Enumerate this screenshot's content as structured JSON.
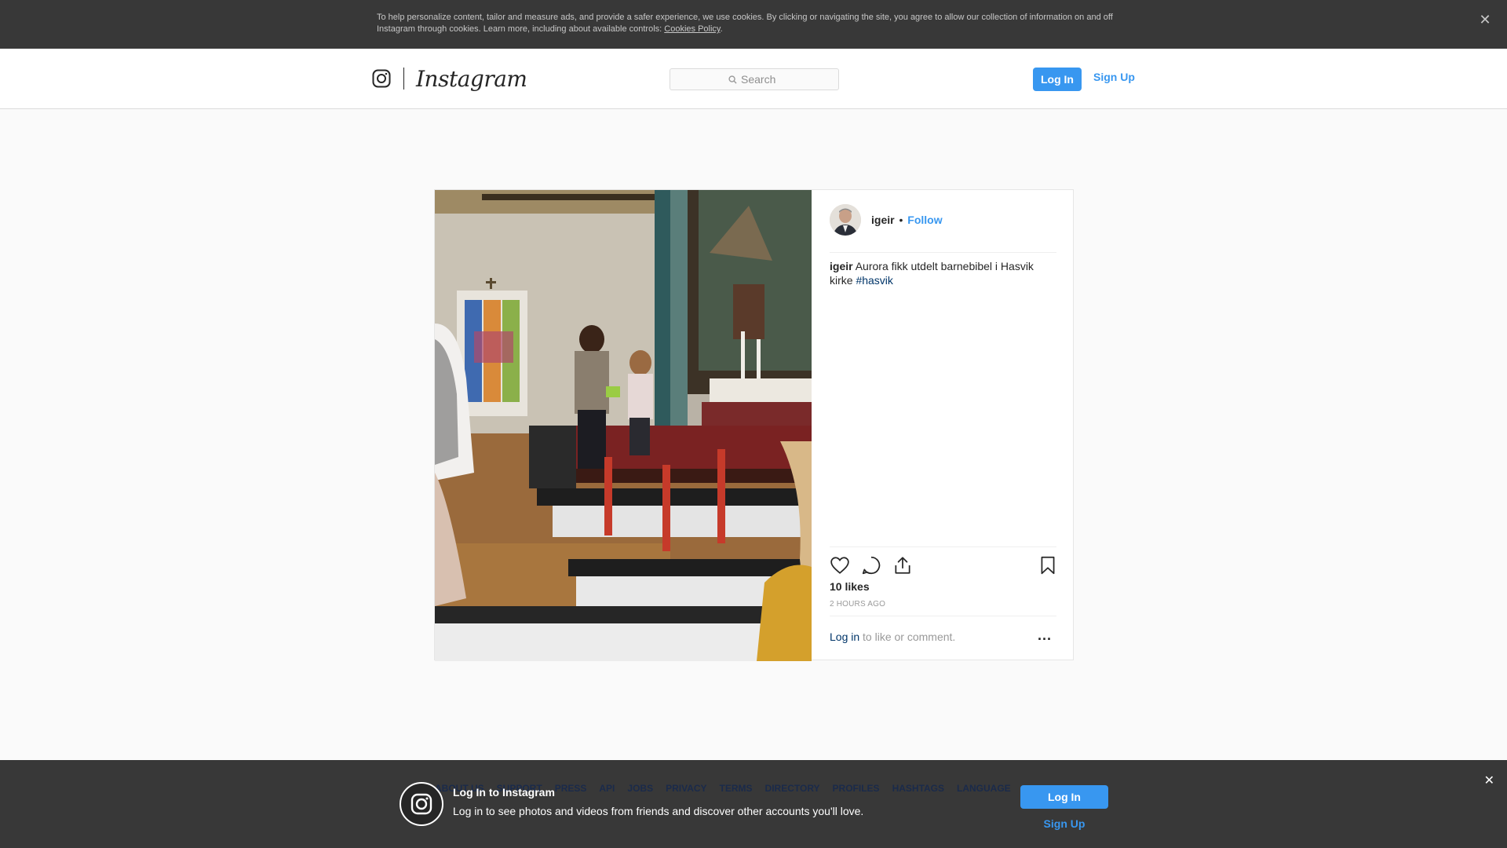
{
  "cookie_banner": {
    "text": "To help personalize content, tailor and measure ads, and provide a safer experience, we use cookies. By clicking or navigating the site, you agree to allow our collection of information on and off Instagram through cookies. Learn more, including about available controls: ",
    "link_label": "Cookies Policy",
    "period": ".",
    "close_icon": "close-icon"
  },
  "nav": {
    "logo_icon": "instagram-camera-icon",
    "wordmark": "Instagram",
    "search_placeholder": "Search",
    "search_icon": "search-icon",
    "login_label": "Log In",
    "signup_label": "Sign Up"
  },
  "post": {
    "author": "igeir",
    "separator": "•",
    "follow_label": "Follow",
    "caption_user": "igeir",
    "caption_text": "Aurora fikk utdelt barnebibel i Hasvik kirke",
    "hashtag": "#hasvik",
    "likes": "10 likes",
    "time": "2 HOURS AGO",
    "login_link": "Log in",
    "comment_prompt": " to like or comment.",
    "more_label": "...",
    "icons": [
      "heart-icon",
      "comment-icon",
      "share-icon",
      "bookmark-icon"
    ]
  },
  "footer_links": [
    "ABOUT US",
    "SUPPORT",
    "PRESS",
    "API",
    "JOBS",
    "PRIVACY",
    "TERMS",
    "DIRECTORY",
    "PROFILES",
    "HASHTAGS",
    "LANGUAGE"
  ],
  "app_banner": {
    "title": "Log In to Instagram",
    "subtitle": "Log in to see photos and videos from friends and discover other accounts you'll love.",
    "login_label": "Log In",
    "signup_label": "Sign Up",
    "close_icon": "close-icon"
  },
  "colors": {
    "accent": "#3897f0",
    "link_dark": "#003569",
    "banner_bg": "#383838"
  }
}
